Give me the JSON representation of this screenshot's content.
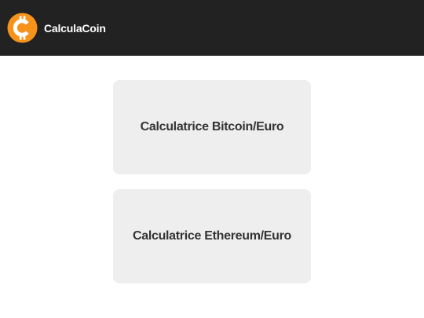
{
  "header": {
    "logo_icon": "bitcoin-icon",
    "brand_name": "CalculaCoin",
    "background_color": "#222222",
    "logo_color": "#f7931a"
  },
  "main": {
    "cards": [
      {
        "label": "Calculatrice Bitcoin/Euro"
      },
      {
        "label": "Calculatrice Ethereum/Euro"
      }
    ],
    "card_background": "#eeeeee",
    "text_color": "#333333"
  }
}
